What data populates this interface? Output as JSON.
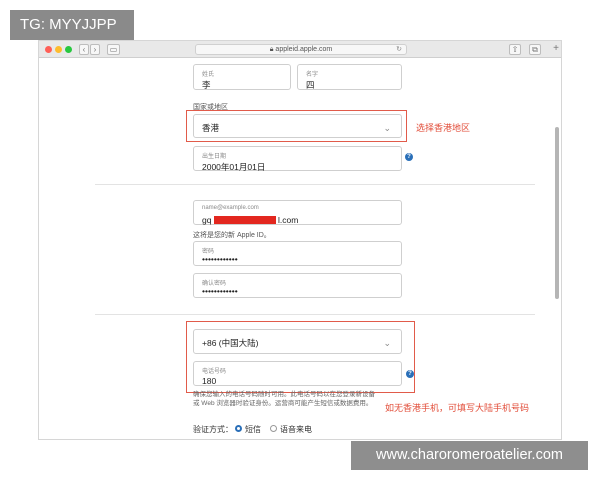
{
  "badge": {
    "text": "TG: MYYJJPP"
  },
  "browser": {
    "url": "appleid.apple.com",
    "lock_icon": "lock-icon",
    "reload_icon": "reload-icon"
  },
  "name": {
    "last_label": "姓氏",
    "last_value": "李",
    "first_label": "名字",
    "first_value": "四"
  },
  "region": {
    "section_label": "国家或地区",
    "value": "香港",
    "annotation": "选择香港地区"
  },
  "birth": {
    "label": "出生日期",
    "value": "2000年01月01日"
  },
  "account": {
    "email_label": "name@example.com",
    "email_prefix": "gq",
    "email_suffix": "l.com",
    "note": "这将是您的新 Apple ID。",
    "password_label": "密码",
    "password_value": "••••••••••••",
    "confirm_label": "确认密码",
    "confirm_value": "••••••••••••"
  },
  "phone": {
    "country_value": "+86 (中国大陆)",
    "number_label": "电话号码",
    "number_value": "180",
    "hint_line1": "确保您输入的电话号码随时可用。此电话号码以在您登录新设备",
    "hint_line2": "或 Web 浏览器时验证身份。运营商可能产生短信或数据费用。",
    "annotation": "如无香港手机，可填写大陆手机号码"
  },
  "verify": {
    "label": "验证方式：",
    "option_sms": "短信",
    "option_call": "语音来电",
    "selected": "短信"
  },
  "colors": {
    "accent": "#2a6fb8",
    "annotation": "#e24d39",
    "redaction": "#e3271f"
  },
  "watermark": {
    "text": "www.charoromeroatelier.com"
  }
}
